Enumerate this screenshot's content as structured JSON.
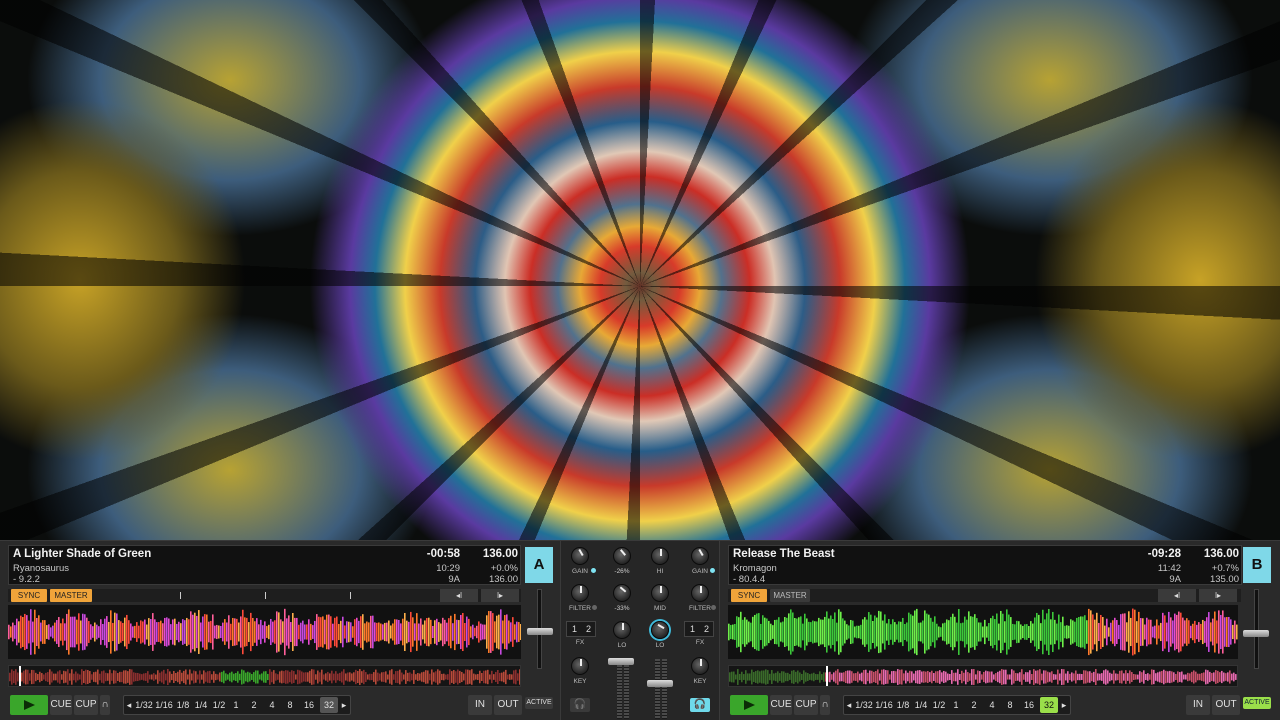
{
  "colors": {
    "sync": "#f0a43a",
    "deck_letter": "#7fd8e8",
    "play": "#3aa62b",
    "loop_active": "#9adf4a",
    "active": "#9adf4a"
  },
  "deck_a": {
    "letter": "A",
    "title": "A Lighter Shade of Green",
    "artist": "Ryanosaurus",
    "extra": "- 9.2.2",
    "remaining": "-00:58",
    "length": "10:29",
    "key": "9A",
    "bpm": "136.00",
    "pitch": "+0.0%",
    "original_bpm": "136.00",
    "sync_label": "SYNC",
    "master_label": "MASTER",
    "nudge_back": "◂ǀ",
    "nudge_fwd": "ǀ▸",
    "cue_label": "CUE",
    "cup_label": "CUP",
    "flux_label": "∩",
    "loop_sizes": [
      "1/32",
      "1/16",
      "1/8",
      "1/4",
      "1/2",
      "1",
      "2",
      "4",
      "8",
      "16",
      "32"
    ],
    "loop_active": "32",
    "in_label": "IN",
    "out_label": "OUT",
    "active_label": "ACTIVE",
    "prev_arrow": "◂",
    "next_arrow": "▸",
    "playhead_fraction": 0.02
  },
  "deck_b": {
    "letter": "B",
    "title": "Release The Beast",
    "artist": "Kromagon",
    "extra": "- 80.4.4",
    "remaining": "-09:28",
    "length": "11:42",
    "key": "9A",
    "bpm": "136.00",
    "pitch": "+0.7%",
    "original_bpm": "135.00",
    "sync_label": "SYNC",
    "master_label": "MASTER",
    "nudge_back": "◂ǀ",
    "nudge_fwd": "ǀ▸",
    "cue_label": "CUE",
    "cup_label": "CUP",
    "flux_label": "∩",
    "loop_sizes": [
      "1/32",
      "1/16",
      "1/8",
      "1/4",
      "1/2",
      "1",
      "2",
      "4",
      "8",
      "16",
      "32"
    ],
    "loop_active": "32",
    "in_label": "IN",
    "out_label": "OUT",
    "active_label": "ACTIVE",
    "prev_arrow": "◂",
    "next_arrow": "▸",
    "cue_points": [
      "2",
      "3"
    ],
    "playhead_fraction": 0.19
  },
  "mixer": {
    "gain_label": "GAIN",
    "filter_label": "FILTER",
    "fx_label": "FX",
    "hi_label": "HI",
    "mid_label": "MID",
    "lo_label": "LO",
    "key_label": "KEY",
    "hi_value": "-26%",
    "mid_value": "-33%",
    "fx_1": "1",
    "fx_2": "2"
  }
}
